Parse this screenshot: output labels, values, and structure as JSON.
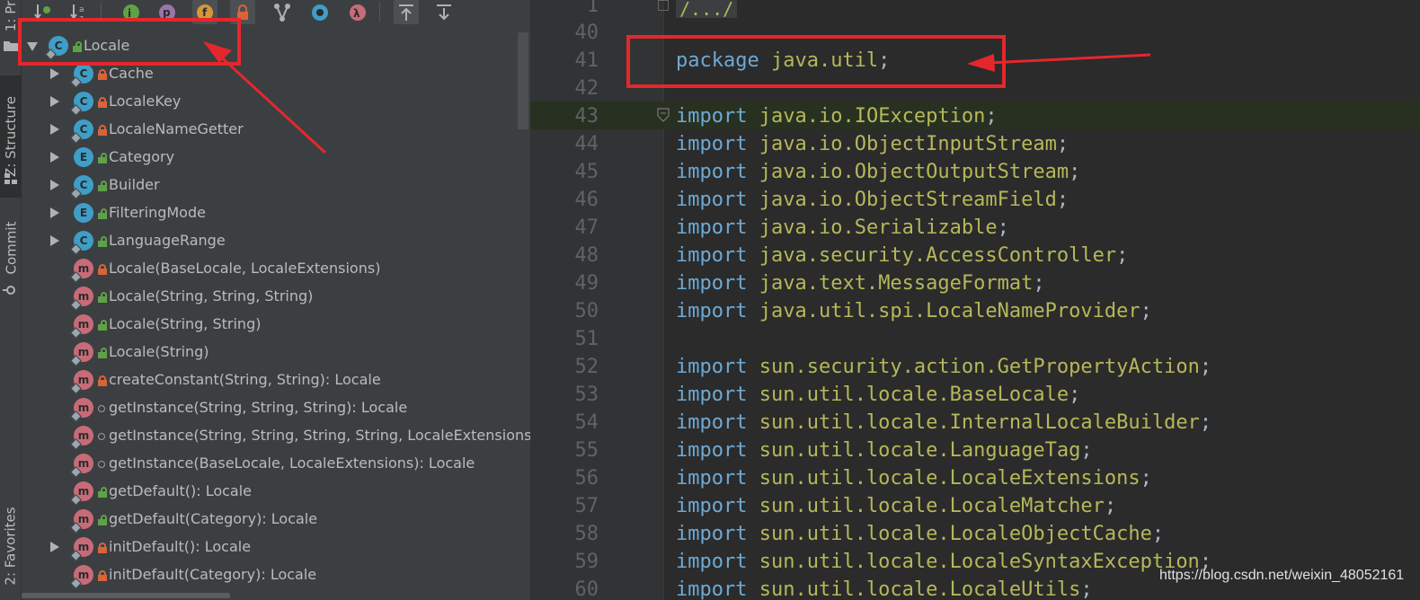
{
  "left_strip": {
    "tabs": [
      {
        "id": "project",
        "label": "1: Pr"
      },
      {
        "id": "structure",
        "label": "Z: Structure"
      },
      {
        "id": "commit",
        "label": "Commit"
      },
      {
        "id": "favorites",
        "label": "2: Favorites"
      }
    ]
  },
  "structure_panel": {
    "toolbar": [
      {
        "name": "sort-by-visibility-icon"
      },
      {
        "name": "sort-alphabetically-icon"
      },
      {
        "name": "show-inherited-icon"
      },
      {
        "name": "show-properties-icon"
      },
      {
        "name": "show-fields-icon"
      },
      {
        "name": "show-non-public-icon"
      },
      {
        "name": "show-anonymous-icon"
      },
      {
        "name": "show-lambdas-icon"
      },
      {
        "name": "autoscroll-to-source-icon"
      },
      {
        "name": "autoscroll-from-source-icon"
      }
    ],
    "colors": {
      "class": "#3e9ec7",
      "method": "#c86b78",
      "private": "#d8643a",
      "public": "#5fa246"
    },
    "tree": [
      {
        "label": "Locale",
        "kind": "c",
        "visibility": "public",
        "arrow": "down",
        "indent": 0
      },
      {
        "label": "Cache",
        "kind": "c",
        "visibility": "private",
        "arrow": "right",
        "indent": 1
      },
      {
        "label": "LocaleKey",
        "kind": "c",
        "visibility": "private",
        "arrow": "right",
        "indent": 1
      },
      {
        "label": "LocaleNameGetter",
        "kind": "c",
        "visibility": "private",
        "arrow": "right",
        "indent": 1
      },
      {
        "label": "Category",
        "kind": "e",
        "visibility": "public",
        "arrow": "right",
        "indent": 1
      },
      {
        "label": "Builder",
        "kind": "c",
        "visibility": "public",
        "arrow": "right",
        "indent": 1
      },
      {
        "label": "FilteringMode",
        "kind": "e",
        "visibility": "public",
        "arrow": "right",
        "indent": 1
      },
      {
        "label": "LanguageRange",
        "kind": "c",
        "visibility": "public",
        "arrow": "right",
        "indent": 1
      },
      {
        "label": "Locale(BaseLocale, LocaleExtensions)",
        "kind": "m",
        "visibility": "private",
        "arrow": "",
        "indent": 1
      },
      {
        "label": "Locale(String, String, String)",
        "kind": "m",
        "visibility": "public",
        "arrow": "",
        "indent": 1
      },
      {
        "label": "Locale(String, String)",
        "kind": "m",
        "visibility": "public",
        "arrow": "",
        "indent": 1
      },
      {
        "label": "Locale(String)",
        "kind": "m",
        "visibility": "public",
        "arrow": "",
        "indent": 1
      },
      {
        "label": "createConstant(String, String): Locale",
        "kind": "m",
        "visibility": "private",
        "arrow": "",
        "indent": 1
      },
      {
        "label": "getInstance(String, String, String): Locale",
        "kind": "m",
        "visibility": "package",
        "arrow": "",
        "indent": 1
      },
      {
        "label": "getInstance(String, String, String, String, LocaleExtensions",
        "kind": "m",
        "visibility": "package",
        "arrow": "",
        "indent": 1
      },
      {
        "label": "getInstance(BaseLocale, LocaleExtensions): Locale",
        "kind": "m",
        "visibility": "package",
        "arrow": "",
        "indent": 1
      },
      {
        "label": "getDefault(): Locale",
        "kind": "m",
        "visibility": "public",
        "arrow": "",
        "indent": 1
      },
      {
        "label": "getDefault(Category): Locale",
        "kind": "m",
        "visibility": "public",
        "arrow": "",
        "indent": 1
      },
      {
        "label": "initDefault(): Locale",
        "kind": "m",
        "visibility": "private",
        "arrow": "right",
        "indent": 1
      },
      {
        "label": "initDefault(Category): Locale",
        "kind": "m",
        "visibility": "private",
        "arrow": "",
        "indent": 1
      }
    ]
  },
  "editor": {
    "collapsed_comment": "/.../",
    "lines": [
      {
        "num": "1",
        "kw": "",
        "pkg": "",
        "cls": "",
        "semi": ""
      },
      {
        "num": "40",
        "kw": "",
        "pkg": "",
        "cls": "",
        "semi": ""
      },
      {
        "num": "41",
        "kw": "package",
        "pkg": " java.util",
        "cls": "",
        "semi": ";"
      },
      {
        "num": "42",
        "kw": "",
        "pkg": "",
        "cls": "",
        "semi": ""
      },
      {
        "num": "43",
        "kw": "import",
        "pkg": " java.io.",
        "cls": "IOException",
        "semi": ";"
      },
      {
        "num": "44",
        "kw": "import",
        "pkg": " java.io.",
        "cls": "ObjectInputStream",
        "semi": ";"
      },
      {
        "num": "45",
        "kw": "import",
        "pkg": " java.io.",
        "cls": "ObjectOutputStream",
        "semi": ";"
      },
      {
        "num": "46",
        "kw": "import",
        "pkg": " java.io.",
        "cls": "ObjectStreamField",
        "semi": ";"
      },
      {
        "num": "47",
        "kw": "import",
        "pkg": " java.io.",
        "cls": "Serializable",
        "semi": ";"
      },
      {
        "num": "48",
        "kw": "import",
        "pkg": " java.security.",
        "cls": "AccessController",
        "semi": ";"
      },
      {
        "num": "49",
        "kw": "import",
        "pkg": " java.text.",
        "cls": "MessageFormat",
        "semi": ";"
      },
      {
        "num": "50",
        "kw": "import",
        "pkg": " java.util.spi.",
        "cls": "LocaleNameProvider",
        "semi": ";"
      },
      {
        "num": "51",
        "kw": "",
        "pkg": "",
        "cls": "",
        "semi": ""
      },
      {
        "num": "52",
        "kw": "import",
        "pkg": " sun.security.action.",
        "cls": "GetPropertyAction",
        "semi": ";"
      },
      {
        "num": "53",
        "kw": "import",
        "pkg": " sun.util.locale.",
        "cls": "BaseLocale",
        "semi": ";"
      },
      {
        "num": "54",
        "kw": "import",
        "pkg": " sun.util.locale.",
        "cls": "InternalLocaleBuilder",
        "semi": ";"
      },
      {
        "num": "55",
        "kw": "import",
        "pkg": " sun.util.locale.",
        "cls": "LanguageTag",
        "semi": ";"
      },
      {
        "num": "56",
        "kw": "import",
        "pkg": " sun.util.locale.",
        "cls": "LocaleExtensions",
        "semi": ";"
      },
      {
        "num": "57",
        "kw": "import",
        "pkg": " sun.util.locale.",
        "cls": "LocaleMatcher",
        "semi": ";"
      },
      {
        "num": "58",
        "kw": "import",
        "pkg": " sun.util.locale.",
        "cls": "LocaleObjectCache",
        "semi": ";"
      },
      {
        "num": "59",
        "kw": "import",
        "pkg": " sun.util.locale.",
        "cls": "LocaleSyntaxException",
        "semi": ";"
      },
      {
        "num": "60",
        "kw": "import",
        "pkg": " sun.util.locale.",
        "cls": "LocaleUtils",
        "semi": ";"
      }
    ]
  },
  "watermark": "https://blog.csdn.net/weixin_48052161",
  "annotation_color": "#e5272c"
}
